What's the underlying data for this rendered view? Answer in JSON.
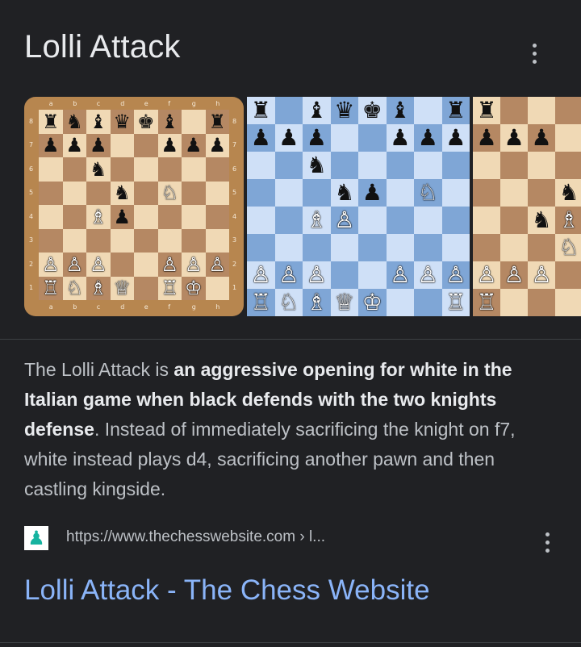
{
  "header": {
    "title": "Lolli Attack",
    "more_icon": "more-vert-icon"
  },
  "images": [
    {
      "name": "board-image-1",
      "rows": [
        "rnbqkb.r",
        "ppp..ppp",
        "..n.....",
        "...n.N..",
        "..Bp....",
        "........",
        "PPP..PPP",
        "RNBQ.RK."
      ],
      "files": [
        "a",
        "b",
        "c",
        "d",
        "e",
        "f",
        "g",
        "h"
      ],
      "ranks": [
        "8",
        "7",
        "6",
        "5",
        "4",
        "3",
        "2",
        "1"
      ]
    },
    {
      "name": "board-image-2",
      "rows": [
        "r.bqkb.r",
        "ppp..ppp",
        "..n.....",
        "...np.N.",
        "..BP....",
        "........",
        "PPP..PPP",
        "RNBQK..R"
      ]
    },
    {
      "name": "board-image-3",
      "rows": [
        "r...kb.r",
        "ppp.....",
        "........",
        "...n....",
        "..nBP...",
        "...N....",
        "PPP.....",
        "R...B..."
      ]
    }
  ],
  "description": {
    "intro": "The Lolli Attack is ",
    "bold": "an aggressive opening for white in the Italian game when black defends with the two knights defense",
    "rest": ". Instead of immediately sacrificing the knight on f7, white instead plays d4, sacrificing another pawn and then castling kingside."
  },
  "source": {
    "favicon": "chess-pawn-icon",
    "url": "https://www.thechesswebsite.com › l...",
    "more_icon": "more-vert-icon"
  },
  "result": {
    "title": "Lolli Attack - The Chess Website"
  },
  "colors": {
    "background": "#202124",
    "link": "#8ab4f8",
    "text": "#bdc1c6"
  }
}
